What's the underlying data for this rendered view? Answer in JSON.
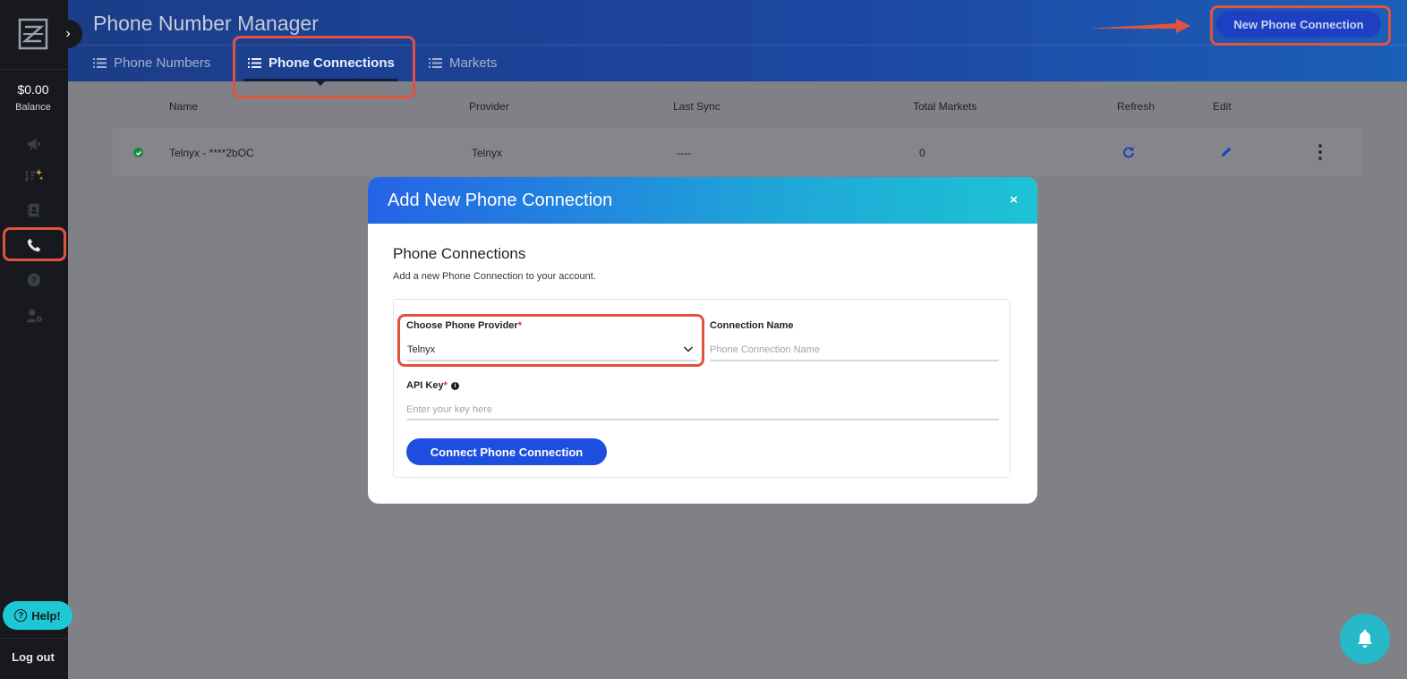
{
  "header": {
    "title": "Phone Number Manager",
    "new_connection_label": "New Phone Connection",
    "tabs": [
      {
        "label": "Phone Numbers"
      },
      {
        "label": "Phone Connections"
      },
      {
        "label": "Markets"
      }
    ]
  },
  "sidebar": {
    "balance_amount": "$0.00",
    "balance_label": "Balance",
    "help_label": "Help!",
    "logout_label": "Log out",
    "icons": [
      "megaphone-icon",
      "sort-sparkle-icon",
      "contacts-icon",
      "phone-icon",
      "question-icon",
      "user-gear-icon"
    ]
  },
  "table": {
    "columns": [
      "Name",
      "Provider",
      "Last Sync",
      "Total Markets",
      "Refresh",
      "Edit"
    ],
    "rows": [
      {
        "name": "Telnyx - ****2bOC",
        "provider": "Telnyx",
        "last_sync": "----",
        "total_markets": "0"
      }
    ]
  },
  "modal": {
    "title": "Add New Phone Connection",
    "close": "×",
    "section_title": "Phone Connections",
    "section_subtitle": "Add a new Phone Connection to your account.",
    "provider_label": "Choose Phone Provider",
    "provider_value": "Telnyx",
    "connection_name_label": "Connection Name",
    "connection_name_placeholder": "Phone Connection Name",
    "api_key_label": "API Key",
    "api_key_placeholder": "Enter your key here",
    "required_marker": "*",
    "info_marker": "i",
    "submit_label": "Connect Phone Connection"
  },
  "colors": {
    "accent": "#1d4ee0",
    "highlight": "#e2533f",
    "sidebar_bg": "#17191e",
    "help_bg": "#1cc8d3"
  }
}
